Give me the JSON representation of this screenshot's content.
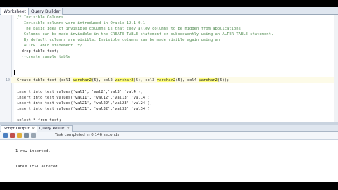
{
  "tabs": {
    "worksheet": "Worksheet",
    "query_builder": "Query Builder"
  },
  "editor": {
    "lines": [
      {
        "n": "",
        "type": "comment",
        "text": "/* Invisible Columns"
      },
      {
        "n": "",
        "type": "comment",
        "text": "   Invisible columns were introduced in Oracle 12.1.0.1"
      },
      {
        "n": "",
        "type": "comment",
        "text": "   The basic idea of invisible columns is that they allow columns to be hidden from applications."
      },
      {
        "n": "",
        "type": "comment",
        "text": "   Columns can be made invisible in the CREATE TABLE statement or subsequently using an ALTER TABLE statement."
      },
      {
        "n": "",
        "type": "comment",
        "text": "   By default columns are visible. Invisible columns can be made visible again using an"
      },
      {
        "n": "",
        "type": "comment",
        "text": "   ALTER TABLE statement. */"
      },
      {
        "n": "",
        "type": "plain",
        "text": "  drop table test;"
      },
      {
        "n": "",
        "type": "comment",
        "text": "  --create sample table"
      },
      {
        "n": "",
        "type": "plain",
        "text": ""
      },
      {
        "n": "10",
        "type": "create",
        "pre": "Create table test (col1 ",
        "hl": "varchar2",
        "seg1": "(5), col2 ",
        "seg2": "(5), col3 ",
        "seg3": "(5), col4 ",
        "post": "(5));"
      },
      {
        "n": "",
        "type": "plain",
        "text": ""
      },
      {
        "n": "",
        "type": "plain",
        "text": "insert into test values('val1', 'val2','val3','val4');"
      },
      {
        "n": "",
        "type": "plain",
        "text": "insert into test values('val11', 'val12','val13','val14');"
      },
      {
        "n": "",
        "type": "plain",
        "text": "insert into test values('val21', 'val22','val23','val24');"
      },
      {
        "n": "",
        "type": "plain",
        "text": "insert into test values('val31', 'val32','val33','val34');"
      },
      {
        "n": "",
        "type": "plain",
        "text": ""
      },
      {
        "n": "",
        "type": "plain",
        "text": "select * from test;"
      }
    ]
  },
  "output_tabs": {
    "script_output": "Script Output",
    "query_result": "Query Result",
    "close": "×"
  },
  "output_toolbar": {
    "status": "Task completed in 0.146 seconds"
  },
  "output": {
    "line1": "1 row inserted.",
    "line2": "Table TEST altered."
  },
  "colors": {
    "comment": "#4f8a4f",
    "keyword_highlight": "#ffff7a"
  }
}
